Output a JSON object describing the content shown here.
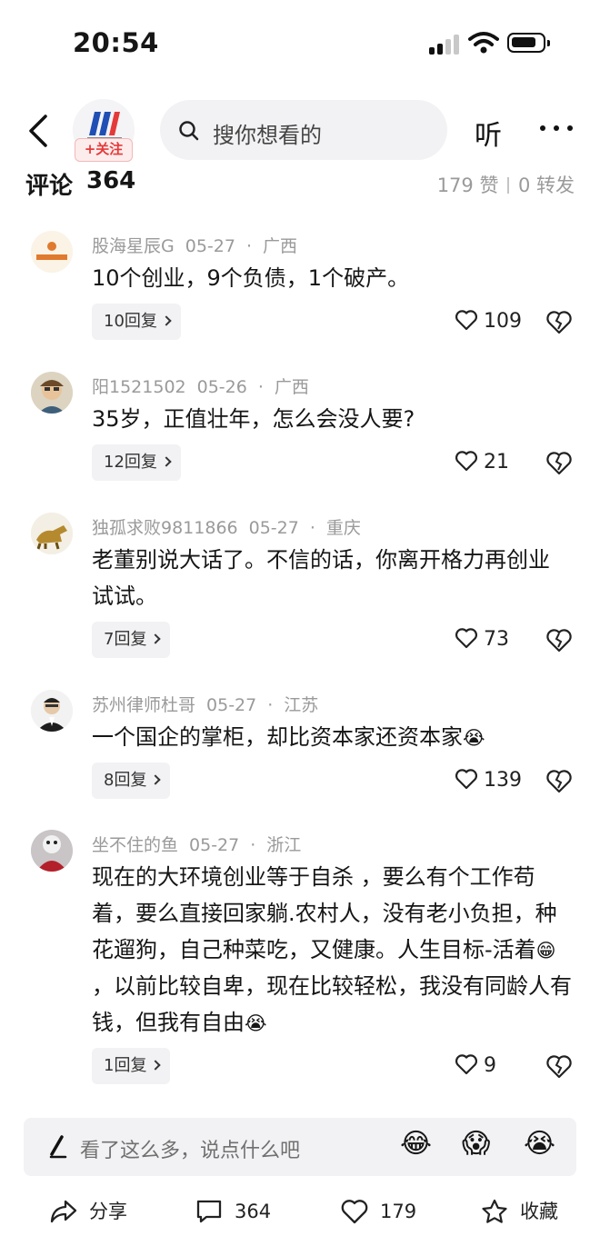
{
  "status": {
    "time": "20:54"
  },
  "nav": {
    "follow_label": "+关注",
    "search_placeholder": "搜你想看的",
    "listen_label": "听"
  },
  "comments_header": {
    "title": "评论",
    "count": "364",
    "likes": "179 赞",
    "shares": "0 转发"
  },
  "comments": [
    {
      "user": "股海星辰G",
      "date": "05-27",
      "location": "广西",
      "text": "10个创业，9个负债，1个破产。",
      "replies": "10回复",
      "likes": "109"
    },
    {
      "user": "阳1521502",
      "date": "05-26",
      "location": "广西",
      "text": "35岁，正值壮年，怎么会没人要?",
      "replies": "12回复",
      "likes": "21"
    },
    {
      "user": "独孤求败9811866",
      "date": "05-27",
      "location": "重庆",
      "text": "老董别说大话了。不信的话，你离开格力再创业试试。",
      "replies": "7回复",
      "likes": "73"
    },
    {
      "user": "苏州律师杜哥",
      "date": "05-27",
      "location": "江苏",
      "text": "一个国企的掌柜，却比资本家还资本家",
      "emoji": "😭",
      "replies": "8回复",
      "likes": "139"
    },
    {
      "user": "坐不住的鱼",
      "date": "05-27",
      "location": "浙江",
      "text_a": "现在的大环境创业等于自杀 ，要么有个工作苟着，要么直接回家躺.农村人，没有老小负担，种花遛狗，自己种菜吃，又健康。人生目标-活着",
      "emoji_a": "😁",
      "text_b": "，以前比较自卑，现在比较轻松，我没有同龄人有钱，但我有自由",
      "emoji_b": "😭",
      "replies": "1回复",
      "likes": "9"
    }
  ],
  "input_bar": {
    "placeholder": "看了这么多，说点什么吧",
    "quick_emojis": [
      "😂",
      "😱",
      "😭"
    ]
  },
  "bottom_bar": {
    "share": "分享",
    "comments": "364",
    "likes": "179",
    "favorite": "收藏"
  }
}
